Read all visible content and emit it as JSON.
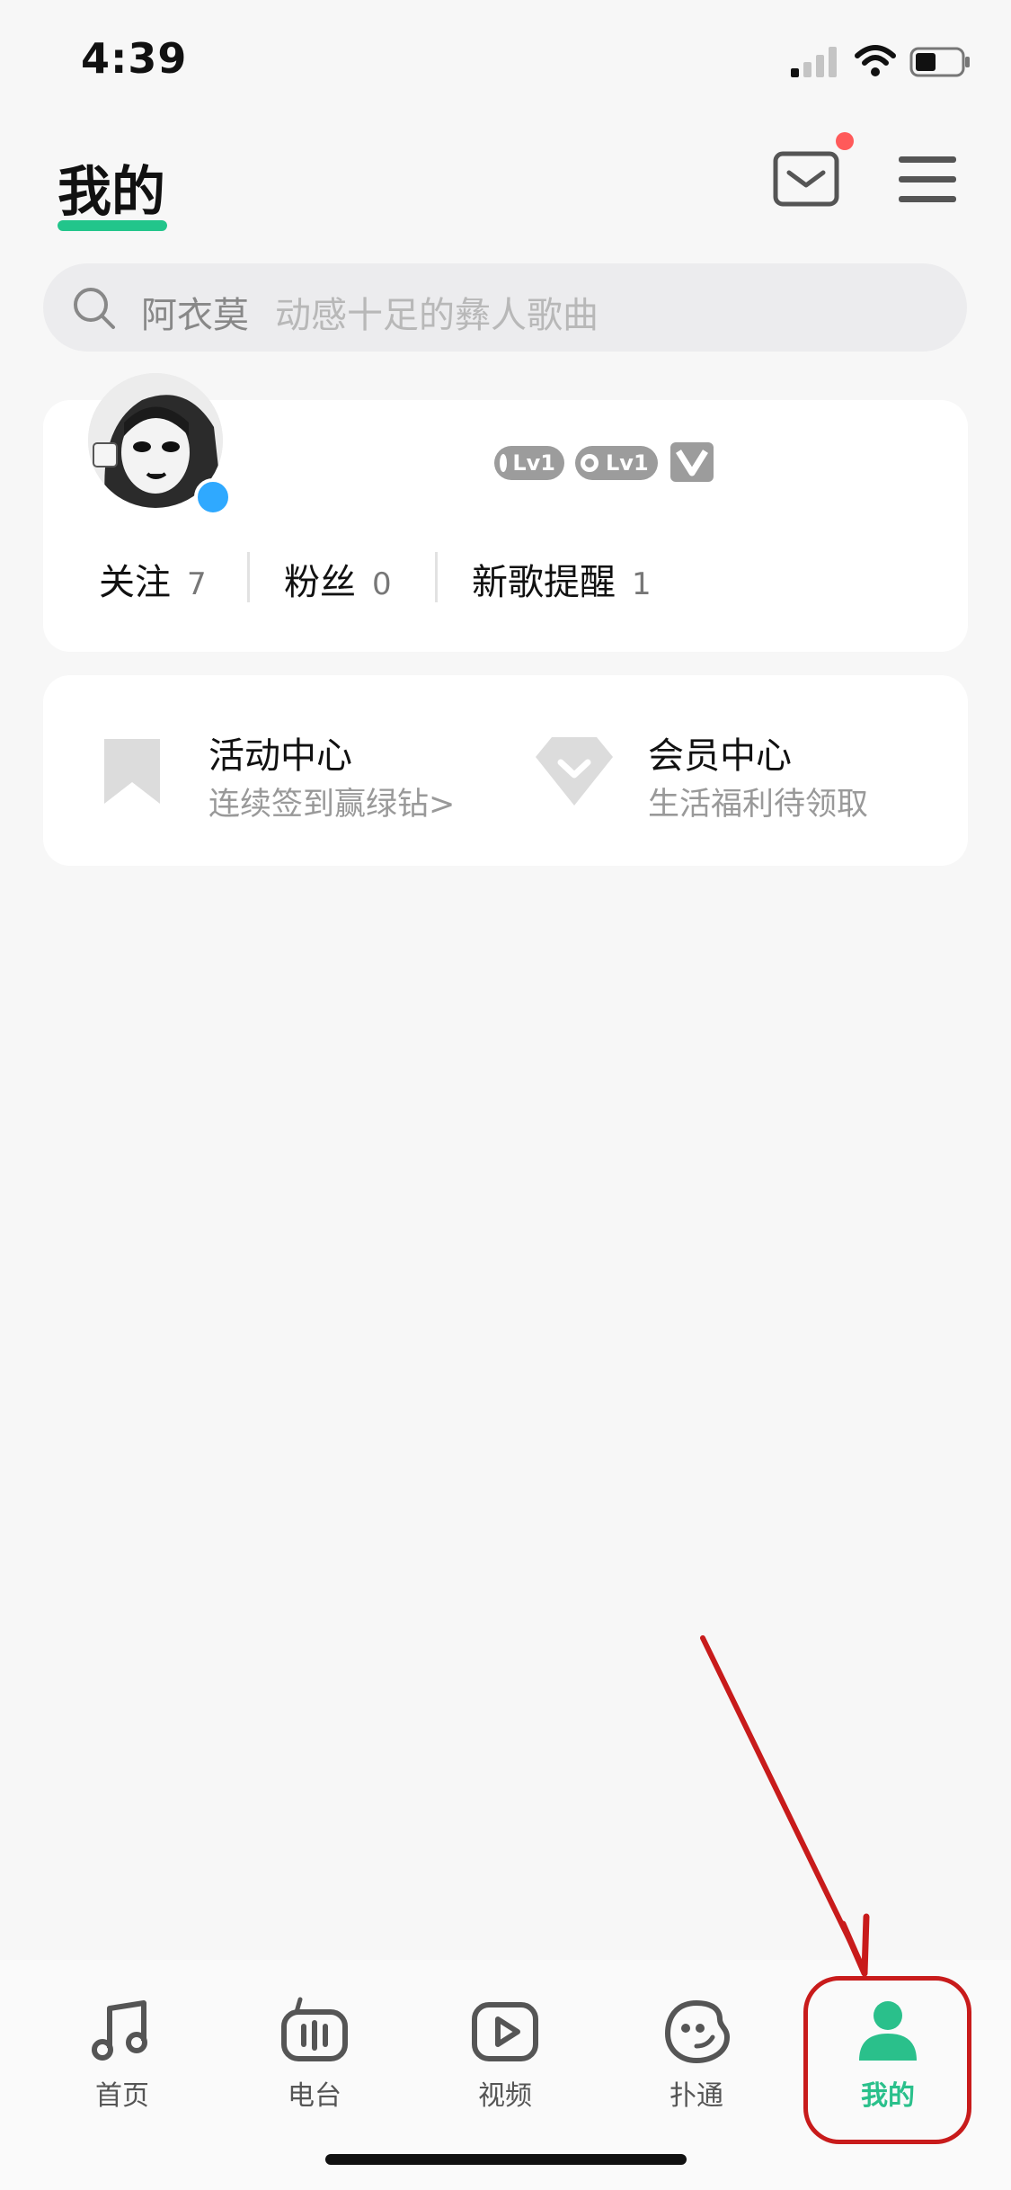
{
  "status_bar": {
    "time": "4:39"
  },
  "header": {
    "title": "我的"
  },
  "search": {
    "keyword": "阿衣莫",
    "placeholder": "动感十足的彝人歌曲"
  },
  "profile": {
    "badges": [
      "Lv1",
      "Lv1"
    ],
    "stats": [
      {
        "label": "关注",
        "value": "7"
      },
      {
        "label": "粉丝",
        "value": "0"
      },
      {
        "label": "新歌提醒",
        "value": "1"
      }
    ]
  },
  "activity": {
    "items": [
      {
        "title": "活动中心",
        "subtitle": "连续签到赢绿钻>",
        "icon": "bookmark-icon"
      },
      {
        "title": "会员中心",
        "subtitle": "生活福利待领取",
        "icon": "diamond-icon"
      }
    ]
  },
  "tabbar": {
    "items": [
      {
        "label": "首页",
        "icon": "music-note-icon"
      },
      {
        "label": "电台",
        "icon": "radio-icon"
      },
      {
        "label": "视频",
        "icon": "play-icon"
      },
      {
        "label": "扑通",
        "icon": "face-icon"
      },
      {
        "label": "我的",
        "icon": "person-icon"
      }
    ],
    "active_color": "#2ac08b"
  },
  "colors": {
    "accent": "#22c58b",
    "annotation": "#c81b1b",
    "notification_dot": "#ff5a5a"
  }
}
